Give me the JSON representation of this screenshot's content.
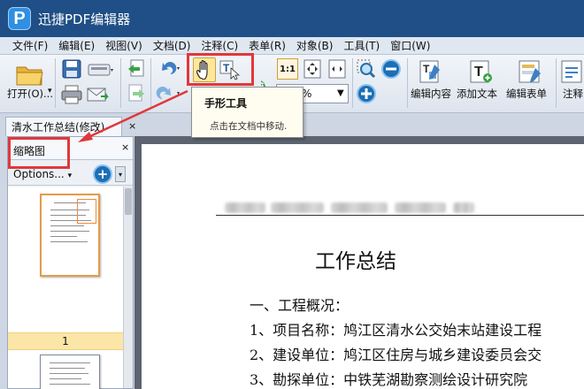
{
  "app": {
    "title": "迅捷PDF编辑器",
    "logo_letter": "P"
  },
  "menu": [
    "文件(F)",
    "编辑(E)",
    "视图(V)",
    "文档(D)",
    "注释(C)",
    "表单(R)",
    "对象(B)",
    "工具(T)",
    "窗口(W)"
  ],
  "toolbar": {
    "open_label": "打开(O)...",
    "fit_label": "1:1",
    "zoom_value": "%",
    "edit_content_label": "编辑内容",
    "add_text_label": "添加文本",
    "edit_form_label": "编辑表单",
    "annotate_label": "注释"
  },
  "tooltip": {
    "title": "手形工具",
    "description": "点击在文档中移动."
  },
  "tab": {
    "label": "清水工作总结(修改)",
    "close": "×"
  },
  "thumbnail_panel": {
    "title": "缩略图",
    "close": "×",
    "options_label": "Options...",
    "options_arrow": "▾",
    "zoom_symbol": "+",
    "zoom_drop": "▾",
    "page_label": "1"
  },
  "document": {
    "title": "工作总结",
    "lines": [
      "一、工程概况：",
      "1、项目名称：鸠江区清水公交始末站建设工程",
      "2、建设单位：鸠江区住房与城乡建设委员会交",
      "3、勘探单位：中铁芜湖勘察测绘设计研究院"
    ]
  },
  "colors": {
    "highlight": "#e0383b",
    "title_bar": "#1f4f86",
    "selected_page": "#fbe6a8"
  }
}
